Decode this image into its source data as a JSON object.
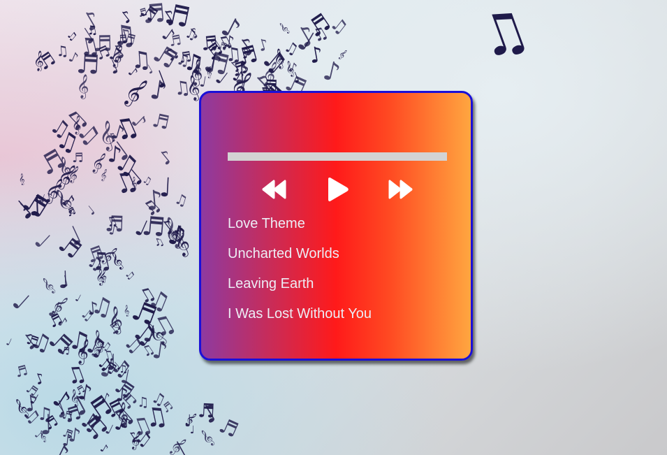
{
  "player": {
    "progress": 0,
    "controls": {
      "rewind_icon": "fast-rewind-icon",
      "play_icon": "play-icon",
      "forward_icon": "fast-forward-icon"
    },
    "tracks": [
      {
        "title": "Love Theme"
      },
      {
        "title": "Uncharted Worlds"
      },
      {
        "title": "Leaving Earth"
      },
      {
        "title": "I Was Lost Without You"
      }
    ]
  },
  "background": {
    "image": "flying-music-notes"
  },
  "colors": {
    "card_border": "#1a10d8",
    "gradient_start": "#8e3aa0",
    "gradient_mid": "#ff1a1a",
    "gradient_end": "#ffa640",
    "progress_bar": "#d3d3d3",
    "track_text": "#ededf5",
    "note_color": "#1f1a4a"
  }
}
